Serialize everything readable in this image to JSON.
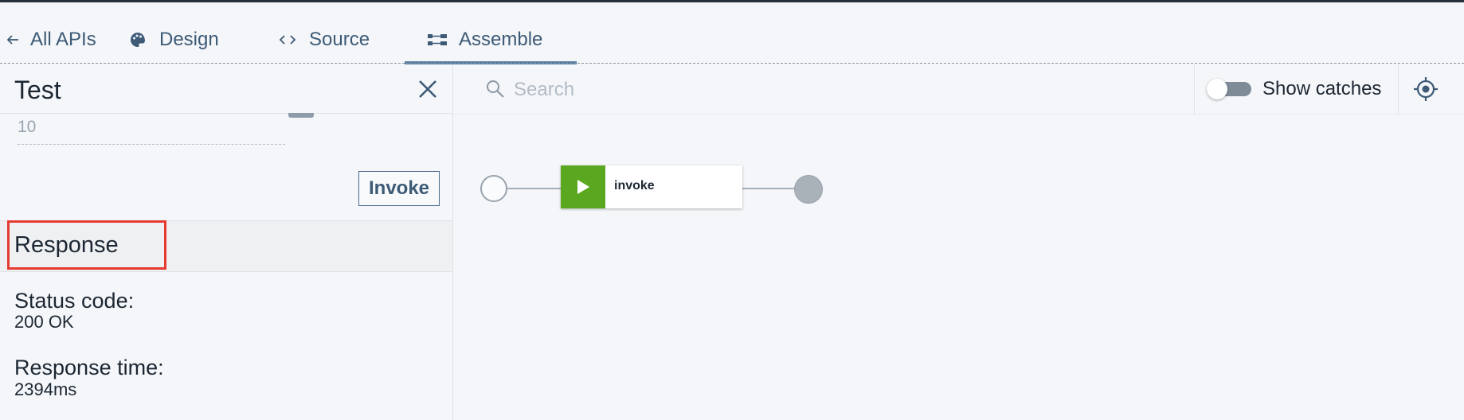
{
  "nav": {
    "back": {
      "label": "All APIs",
      "icon": "arrow-left-icon"
    },
    "tabs": [
      {
        "label": "Design",
        "icon": "palette-icon"
      },
      {
        "label": "Source",
        "icon": "code-icon"
      },
      {
        "label": "Assemble",
        "icon": "flow-icon",
        "active": true
      }
    ]
  },
  "test_panel": {
    "title": "Test",
    "close_icon": "close-icon",
    "previous_field_value": "10",
    "invoke_label": "Invoke",
    "response_heading": "Response",
    "status_code_label": "Status code:",
    "status_code_value": "200 OK",
    "response_time_label": "Response time:",
    "response_time_value": "2394ms"
  },
  "canvas": {
    "search_placeholder": "Search",
    "show_catches_label": "Show catches",
    "show_catches_on": false,
    "target_icon": "locate-icon",
    "flow": {
      "policy_label": "invoke",
      "policy_icon": "play-icon",
      "policy_color": "#5aa81f"
    }
  },
  "colors": {
    "accent": "#5a7fa4",
    "highlight": "#e53b30",
    "text": "#1c2733",
    "nav_text": "#3d5a76"
  }
}
